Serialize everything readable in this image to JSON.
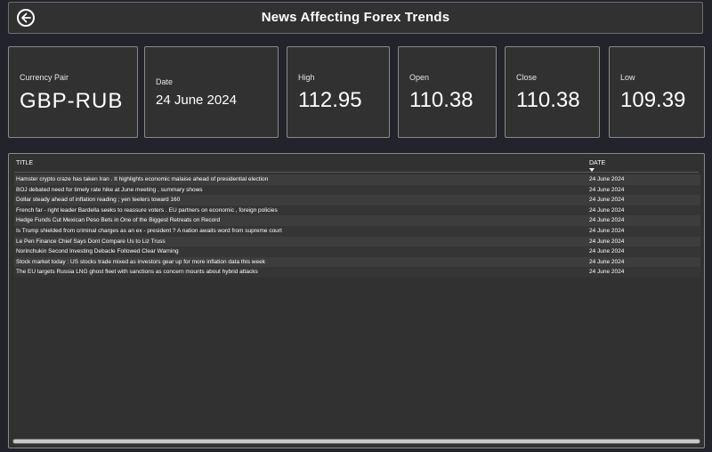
{
  "header": {
    "title": "News Affecting Forex Trends",
    "back_icon": "back-arrow-circle-icon"
  },
  "cards": {
    "currency_pair": {
      "label": "Currency Pair",
      "value": "GBP-RUB"
    },
    "date": {
      "label": "Date",
      "value": "24 June 2024"
    },
    "high": {
      "label": "High",
      "value": "112.95"
    },
    "open": {
      "label": "Open",
      "value": "110.38"
    },
    "close": {
      "label": "Close",
      "value": "110.38"
    },
    "low": {
      "label": "Low",
      "value": "109.39"
    }
  },
  "table": {
    "columns": {
      "title": "TITLE",
      "date": "DATE"
    },
    "rows": [
      {
        "title": "Hamster crypto craze has taken Iran . It highlights economic malaise ahead of presidential election",
        "date": "24 June 2024"
      },
      {
        "title": "BOJ debated need for timely rate hike at June meeting , summary shows",
        "date": "24 June 2024"
      },
      {
        "title": "Dollar steady ahead of inflation reading ; yen teeters toward 160",
        "date": "24 June 2024"
      },
      {
        "title": "French far - right leader Bardella seeks to reassure voters . EU partners on economic , foreign policies",
        "date": "24 June 2024"
      },
      {
        "title": "Hedge Funds Cut Mexican Peso Bets in One of the Biggest Retreats on Record",
        "date": "24 June 2024"
      },
      {
        "title": "Is Trump shielded from criminal charges as an ex - president ? A nation awaits word from supreme court",
        "date": "24 June 2024"
      },
      {
        "title": "Le Pen Finance Chief Says Dont Compare Us to Liz Truss",
        "date": "24 June 2024"
      },
      {
        "title": "Norinchukin Second Investing Debacle Followed Clear Warning",
        "date": "24 June 2024"
      },
      {
        "title": "Stock market today : US stocks trade mixed as investors gear up for more inflation data this week",
        "date": "24 June 2024"
      },
      {
        "title": "The EU targets Russia LNG ghost fleet with sanctions as concern mounts about hybrid attacks",
        "date": "24 June 2024"
      }
    ]
  },
  "colors": {
    "background": "#22232b",
    "panel": "#313131",
    "border": "#8a8a8a",
    "text": "#ffffff"
  }
}
